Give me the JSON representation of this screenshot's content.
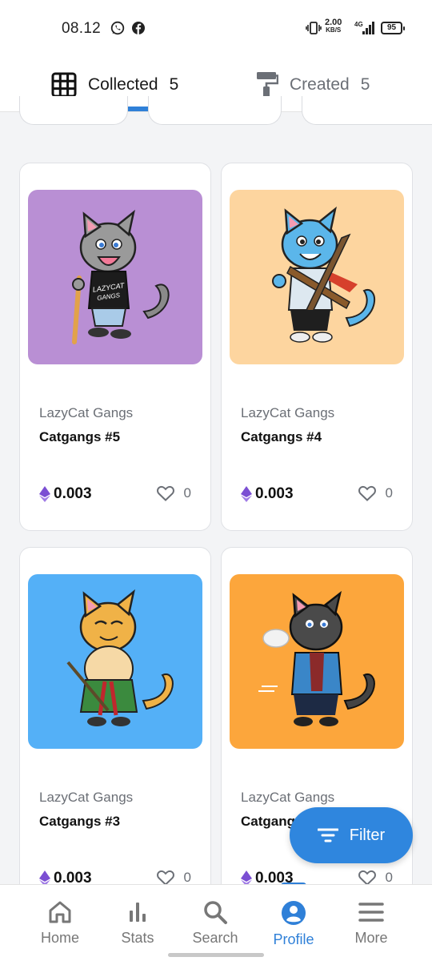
{
  "status_bar": {
    "time": "08.12",
    "net_speed_value": "2.00",
    "net_speed_unit": "KB/S",
    "network": "4G",
    "battery": "95"
  },
  "tabs": [
    {
      "label": "Collected",
      "count": "5",
      "icon": "grid-icon",
      "selected": true
    },
    {
      "label": "Created",
      "count": "5",
      "icon": "paint-roller-icon",
      "selected": false
    }
  ],
  "cards": [
    {
      "collection": "LazyCat Gangs",
      "title": "Catgangs #5",
      "price": "0.003",
      "likes": "0",
      "bg": "#b98fd4",
      "cat": "grey cat with baseball bat"
    },
    {
      "collection": "LazyCat Gangs",
      "title": "Catgangs #4",
      "price": "0.003",
      "likes": "0",
      "bg": "#fdd59f",
      "cat": "blue cat with sword"
    },
    {
      "collection": "LazyCat Gangs",
      "title": "Catgangs #3",
      "price": "0.003",
      "likes": "0",
      "bg": "#54b0f7",
      "cat": "orange cat with sword"
    },
    {
      "collection": "LazyCat Gangs",
      "title": "Catgangs",
      "price": "0.003",
      "likes": "0",
      "bg": "#fca63c",
      "cat": "black cat with jacket"
    }
  ],
  "filter_button": {
    "label": "Filter",
    "icon": "filter-lines-icon"
  },
  "nav": [
    {
      "label": "Home",
      "icon": "home-icon"
    },
    {
      "label": "Stats",
      "icon": "stats-icon"
    },
    {
      "label": "Search",
      "icon": "search-icon"
    },
    {
      "label": "Profile",
      "icon": "profile-icon",
      "selected": true
    },
    {
      "label": "More",
      "icon": "menu-icon"
    }
  ],
  "colors": {
    "accent": "#2f80d8",
    "eth": "#7b4fd3",
    "muted": "#6b6f76"
  }
}
